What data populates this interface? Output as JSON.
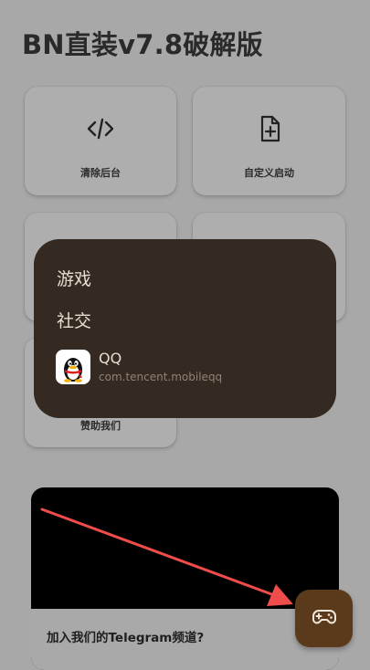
{
  "header": {
    "title": "BN直装v7.8破解版"
  },
  "cards": {
    "clear_background": {
      "label": "清除后台",
      "icon": "code-icon"
    },
    "custom_launch": {
      "label": "自定义启动",
      "icon": "add-file-icon"
    },
    "donate": {
      "label": "赞助我们"
    }
  },
  "popup": {
    "categories": [
      "游戏",
      "社交"
    ],
    "app": {
      "name": "QQ",
      "package": "com.tencent.mobileqq",
      "icon": "qq-penguin-icon"
    }
  },
  "telegram_banner": {
    "text": "加入我们的Telegram频道?"
  },
  "fab": {
    "icon": "gamepad-icon"
  },
  "colors": {
    "background": "#a8a8a8",
    "popup": "#352a21",
    "fab": "#5a3a1a",
    "annotation_arrow": "#ef4c4c"
  }
}
